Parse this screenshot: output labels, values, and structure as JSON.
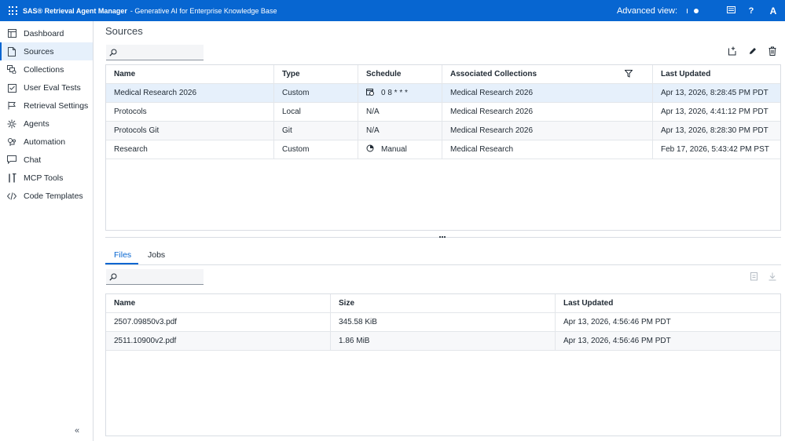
{
  "app": {
    "brand": "SAS® Retrieval Agent Manager",
    "subtitle": "- Generative AI for Enterprise Knowledge Base",
    "advanced_view_label": "Advanced view:",
    "help_label": "?",
    "user_initial": "A"
  },
  "sidebar": {
    "items": [
      {
        "label": "Dashboard",
        "icon": "dashboard-icon"
      },
      {
        "label": "Sources",
        "icon": "document-icon",
        "active": true
      },
      {
        "label": "Collections",
        "icon": "collections-icon"
      },
      {
        "label": "User Eval Tests",
        "icon": "checklist-icon"
      },
      {
        "label": "Retrieval Settings",
        "icon": "settings-flag-icon"
      },
      {
        "label": "Agents",
        "icon": "agents-icon"
      },
      {
        "label": "Automation",
        "icon": "automation-icon"
      },
      {
        "label": "Chat",
        "icon": "chat-icon"
      },
      {
        "label": "MCP Tools",
        "icon": "tools-icon"
      },
      {
        "label": "Code Templates",
        "icon": "code-icon"
      }
    ],
    "collapse_label": "«"
  },
  "page": {
    "title": "Sources"
  },
  "sources_table": {
    "columns": [
      "Name",
      "Type",
      "Schedule",
      "Associated Collections",
      "Last Updated"
    ],
    "rows": [
      {
        "name": "Medical Research 2026",
        "type": "Custom",
        "schedule": "0 8 * * *",
        "schedule_icon": "calendar-clock-icon",
        "collections": "Medical Research 2026",
        "updated": "Apr 13, 2026, 8:28:45 PM PDT",
        "selected": true
      },
      {
        "name": "Protocols",
        "type": "Local",
        "schedule": "N/A",
        "schedule_icon": "",
        "collections": "Medical Research 2026",
        "updated": "Apr 13, 2026, 4:41:12 PM PDT"
      },
      {
        "name": "Protocols Git",
        "type": "Git",
        "schedule": "N/A",
        "schedule_icon": "",
        "collections": "Medical Research 2026",
        "updated": "Apr 13, 2026, 8:28:30 PM PDT"
      },
      {
        "name": "Research",
        "type": "Custom",
        "schedule": "Manual",
        "schedule_icon": "manual-run-icon",
        "collections": "Medical Research",
        "updated": "Feb 17, 2026, 5:43:42 PM PST"
      }
    ]
  },
  "detail_tabs": [
    "Files",
    "Jobs"
  ],
  "files_table": {
    "columns": [
      "Name",
      "Size",
      "Last Updated"
    ],
    "rows": [
      {
        "name": "2507.09850v3.pdf",
        "size": "345.58 KiB",
        "updated": "Apr 13, 2026, 4:56:46 PM PDT"
      },
      {
        "name": "2511.10900v2.pdf",
        "size": "1.86 MiB",
        "updated": "Apr 13, 2026, 4:56:46 PM PDT"
      }
    ]
  },
  "colors": {
    "accent": "#0766d1",
    "selected_row": "#e6f0fb"
  }
}
